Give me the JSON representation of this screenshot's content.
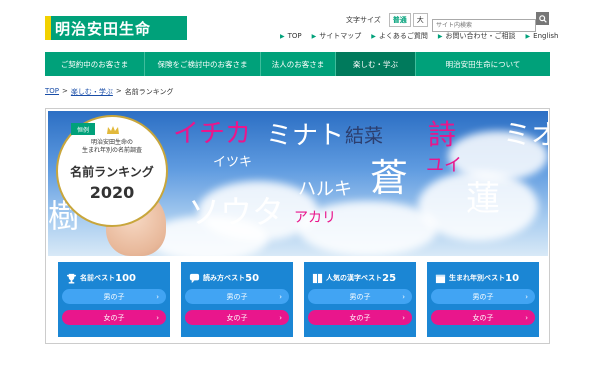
{
  "header": {
    "logo_text": "明治安田生命",
    "textsize_label": "文字サイズ",
    "textsize_normal": "普通",
    "textsize_large": "大",
    "search_placeholder": "サイト内検索",
    "util_links": [
      "TOP",
      "サイトマップ",
      "よくあるご質問",
      "お問い合わせ・ご相談",
      "English"
    ]
  },
  "nav": {
    "items": [
      "ご契約中のお客さま",
      "保険をご検討中のお客さま",
      "法人のお客さま",
      "楽しむ・学ぶ",
      "明治安田生命について"
    ],
    "active_index": 3
  },
  "breadcrumb": {
    "home": "TOP",
    "parent": "楽しむ・学ぶ",
    "current": "名前ランキング",
    "sep": ">"
  },
  "hero": {
    "badge_tag": "恒例",
    "badge_sub1": "明治安田生命の",
    "badge_sub2": "生まれ年別の名前調査",
    "badge_title": "名前ランキング",
    "badge_year": "2020",
    "words": [
      "イチカ",
      "ミナト",
      "結菜",
      "詩",
      "ミオ",
      "イツキ",
      "ユイ",
      "蒼",
      "ハルキ",
      "蓮",
      "ソウタ",
      "アカリ",
      "樹"
    ]
  },
  "cards": [
    {
      "title": "名前ベスト",
      "num": "100",
      "icon": "trophy-icon",
      "boy": "男の子",
      "girl": "女の子"
    },
    {
      "title": "読み方ベスト",
      "num": "50",
      "icon": "speech-icon",
      "boy": "男の子",
      "girl": "女の子"
    },
    {
      "title": "人気の漢字ベスト",
      "num": "25",
      "icon": "book-icon",
      "boy": "男の子",
      "girl": "女の子"
    },
    {
      "title": "生まれ年別ベスト",
      "num": "10",
      "icon": "calendar-icon",
      "boy": "男の子",
      "girl": "女の子"
    }
  ],
  "colors": {
    "brand": "#00a17a",
    "brand_dark": "#007a5c",
    "card_blue": "#1b86d4",
    "boy": "#41a4f3",
    "girl": "#e9168c"
  }
}
